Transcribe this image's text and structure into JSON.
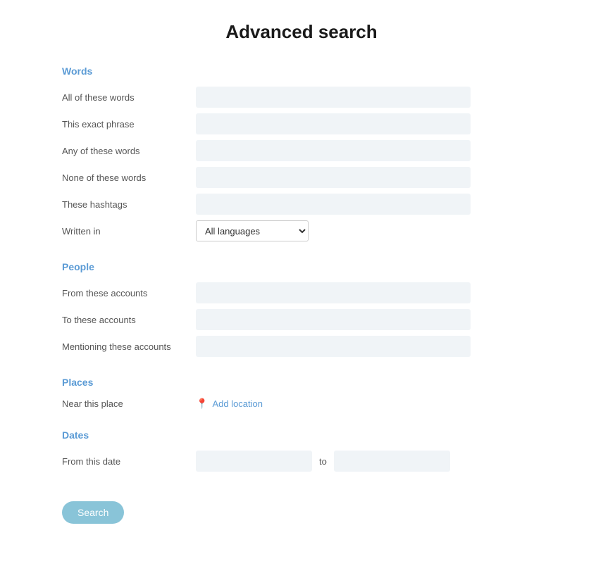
{
  "page": {
    "title": "Advanced search"
  },
  "sections": {
    "words": {
      "title": "Words",
      "fields": [
        {
          "label": "All of these words",
          "key": "all_words"
        },
        {
          "label": "This exact phrase",
          "key": "exact_phrase"
        },
        {
          "label": "Any of these words",
          "key": "any_words"
        },
        {
          "label": "None of these words",
          "key": "none_words"
        },
        {
          "label": "These hashtags",
          "key": "hashtags"
        }
      ],
      "written_in_label": "Written in",
      "language_default": "All languages"
    },
    "people": {
      "title": "People",
      "fields": [
        {
          "label": "From these accounts",
          "key": "from_accounts"
        },
        {
          "label": "To these accounts",
          "key": "to_accounts"
        },
        {
          "label": "Mentioning these accounts",
          "key": "mentioning_accounts"
        }
      ]
    },
    "places": {
      "title": "Places",
      "near_label": "Near this place",
      "add_location_text": "Add location"
    },
    "dates": {
      "title": "Dates",
      "from_label": "From this date",
      "to_label": "to"
    }
  },
  "search_button_label": "Search"
}
